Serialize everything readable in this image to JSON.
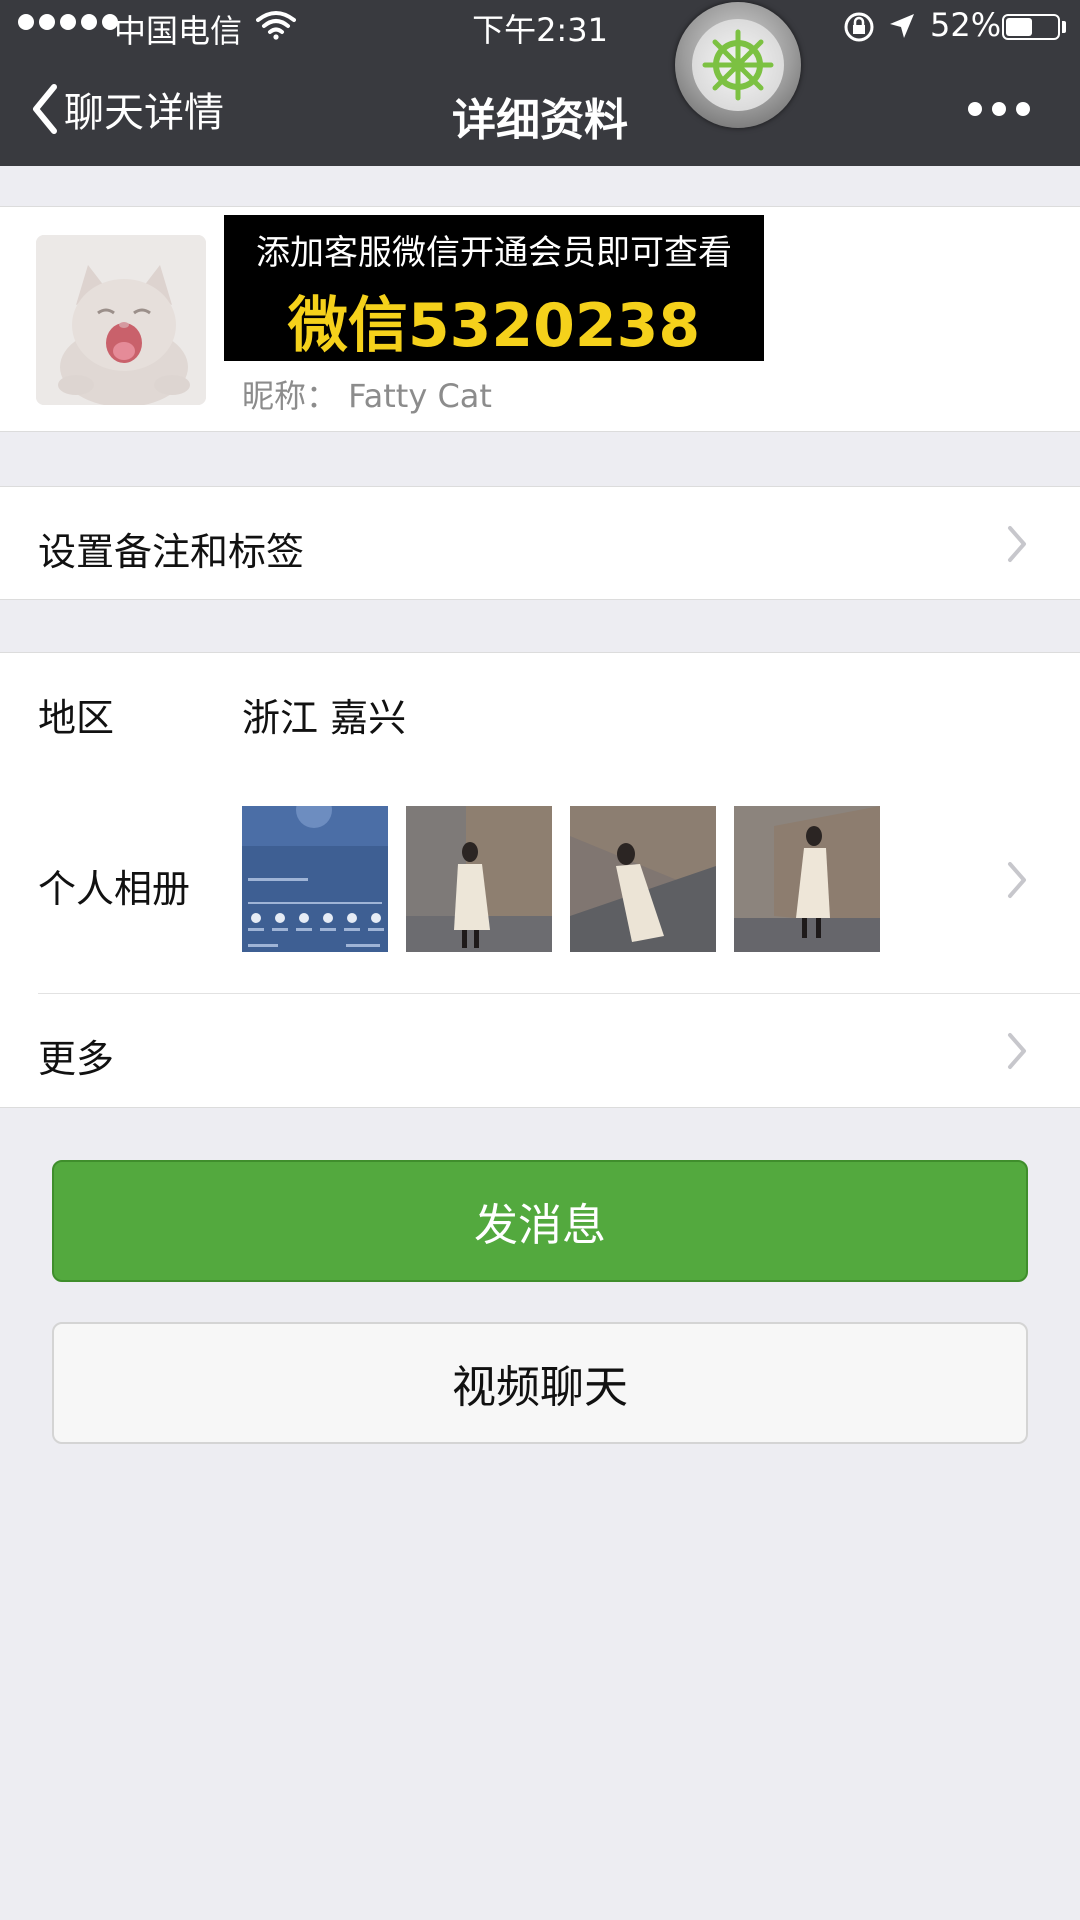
{
  "status_bar": {
    "carrier": "中国电信",
    "time": "下午2:31",
    "battery": "52%",
    "battery_level": 0.52
  },
  "nav": {
    "back_label": "聊天详情",
    "title": "详细资料"
  },
  "profile": {
    "promo_line1": "添加客服微信开通会员即可查看",
    "promo_line2": "微信5320238",
    "nickname": "昵称： Fatty Cat"
  },
  "rows": {
    "remark_label": "设置备注和标签",
    "region_label": "地区",
    "region_value": "浙江 嘉兴",
    "album_label": "个人相册",
    "more_label": "更多"
  },
  "buttons": {
    "send": "发消息",
    "video": "视频聊天"
  },
  "colors": {
    "topbar": "#393a3f",
    "send_button": "#53a93e",
    "promo_text": "#f5d11b"
  }
}
